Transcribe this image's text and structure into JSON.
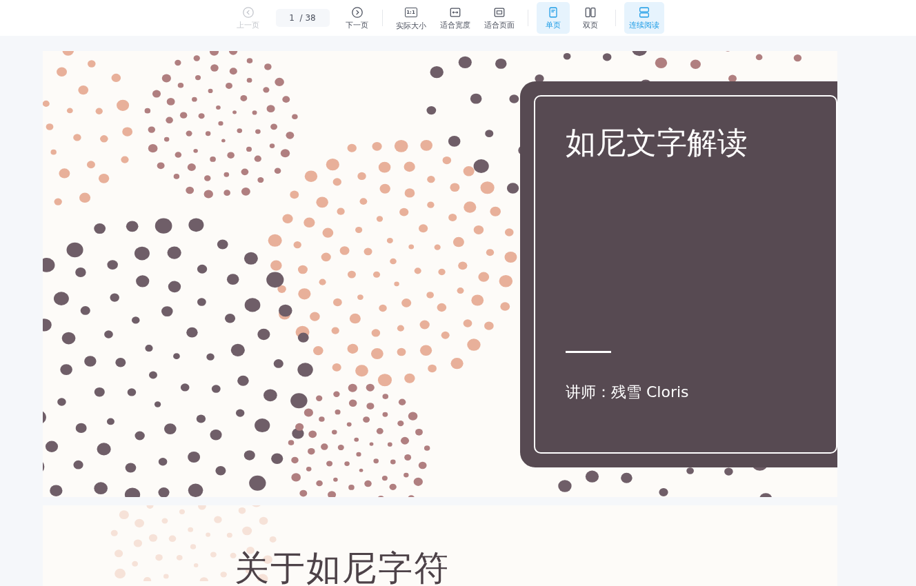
{
  "toolbar": {
    "prev": {
      "label": "上一页",
      "disabled": true
    },
    "page_input": {
      "value": "1",
      "total": "/ 38"
    },
    "next": {
      "label": "下一页",
      "disabled": false
    },
    "zoom_buttons": [
      {
        "kind": "actual",
        "label": "实际大小",
        "icon_text": "1:1"
      },
      {
        "kind": "width",
        "label": "适合宽度"
      },
      {
        "kind": "page",
        "label": "适合页面"
      }
    ],
    "layout_buttons": [
      {
        "kind": "single",
        "label": "单页",
        "selected": true
      },
      {
        "kind": "double",
        "label": "双页",
        "selected": false
      }
    ],
    "continuous": {
      "label": "连续阅读",
      "on": true
    }
  },
  "slides": [
    {
      "kind": "title",
      "title": "如尼文字解读",
      "subtitle": "讲师：残雪 Cloris"
    },
    {
      "kind": "heading",
      "title": "关于如尼字符"
    }
  ]
}
